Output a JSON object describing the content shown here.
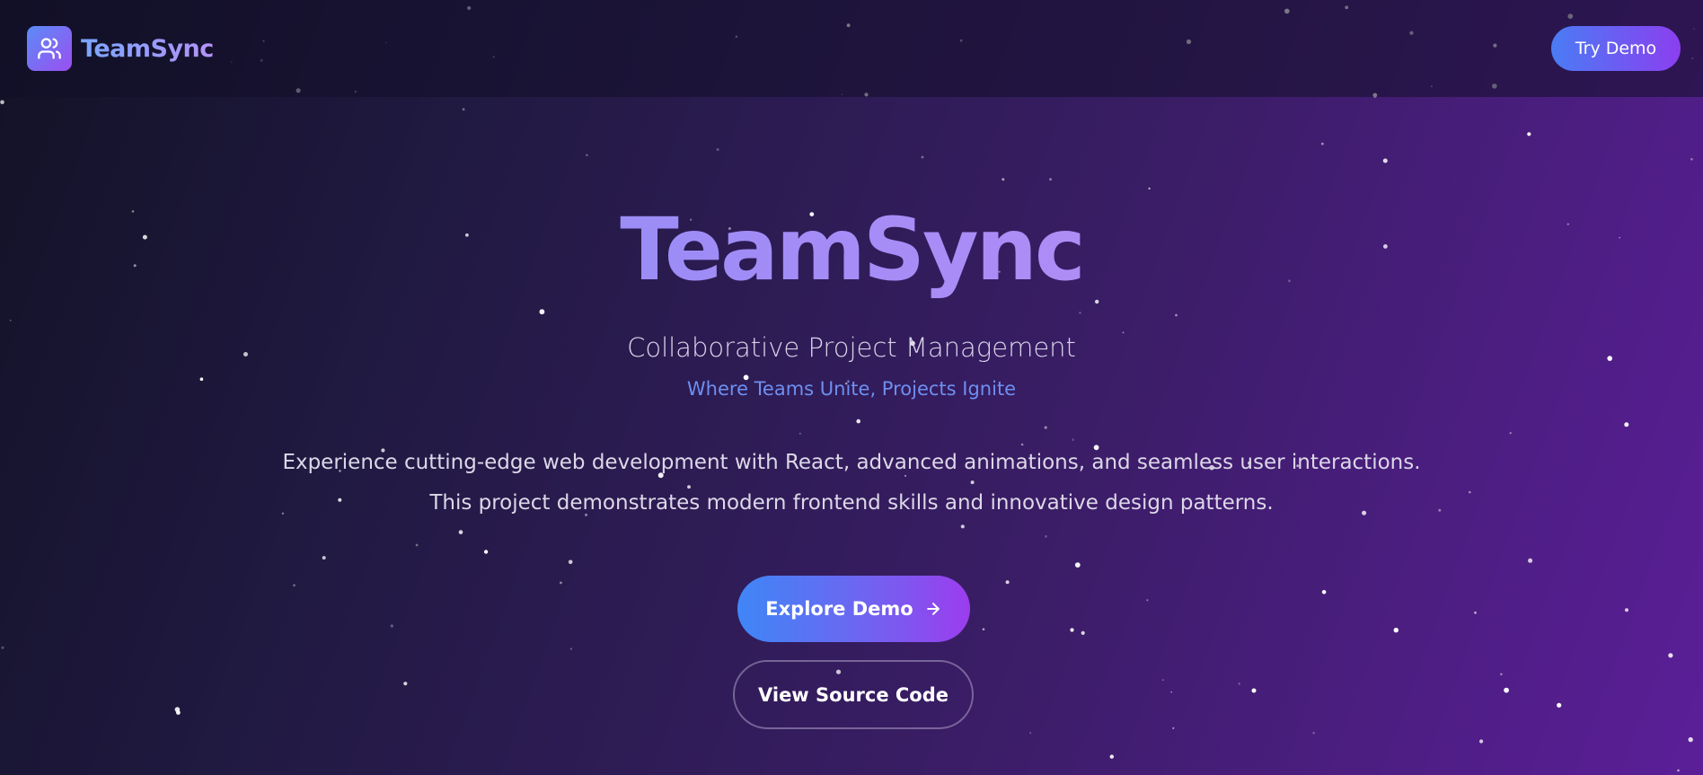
{
  "navbar": {
    "brand_name": "TeamSync",
    "logo_icon": "users-icon",
    "try_demo_label": "Try Demo"
  },
  "hero": {
    "title": "TeamSync",
    "subtitle": "Collaborative Project Management",
    "tagline": "Where Teams Unite, Projects Ignite",
    "description": "Experience cutting-edge web development with React, advanced animations, and seamless user interactions. This project demonstrates modern frontend skills and innovative design patterns.",
    "explore_label": "Explore Demo",
    "explore_icon": "arrow-right-icon",
    "source_label": "View Source Code"
  },
  "colors": {
    "background_start": "#121226",
    "background_end": "#5b1e98",
    "accent_blue": "#4a7cf5",
    "accent_purple": "#8b3fef",
    "tagline": "#6e8ff0"
  }
}
